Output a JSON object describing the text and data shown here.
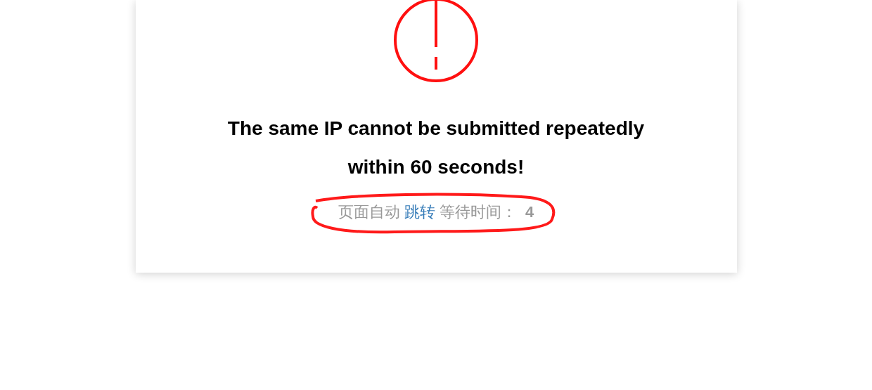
{
  "icon": {
    "kind": "warning"
  },
  "message": [
    "The same IP cannot be submitted repeatedly",
    "within 60 seconds!"
  ],
  "redirect": {
    "prefix": "页面自动",
    "link": "跳转",
    "wait_label": "等待时间：",
    "countdown": "4"
  }
}
